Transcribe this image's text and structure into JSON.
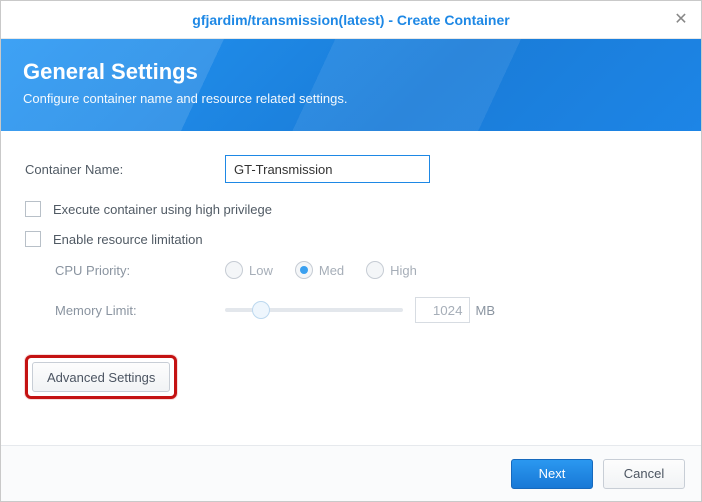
{
  "title": "gfjardim/transmission(latest) - Create Container",
  "banner": {
    "heading": "General Settings",
    "subheading": "Configure container name and resource related settings."
  },
  "form": {
    "containerName": {
      "label": "Container Name:",
      "value": "GT-Transmission"
    },
    "highPrivilege": {
      "label": "Execute container using high privilege",
      "checked": false
    },
    "resourceLimit": {
      "label": "Enable resource limitation",
      "checked": false
    },
    "cpuPriority": {
      "label": "CPU Priority:",
      "options": {
        "low": "Low",
        "med": "Med",
        "high": "High"
      },
      "selected": "med"
    },
    "memoryLimit": {
      "label": "Memory Limit:",
      "value": "1024",
      "unit": "MB"
    },
    "advanced": "Advanced Settings"
  },
  "footer": {
    "next": "Next",
    "cancel": "Cancel"
  }
}
